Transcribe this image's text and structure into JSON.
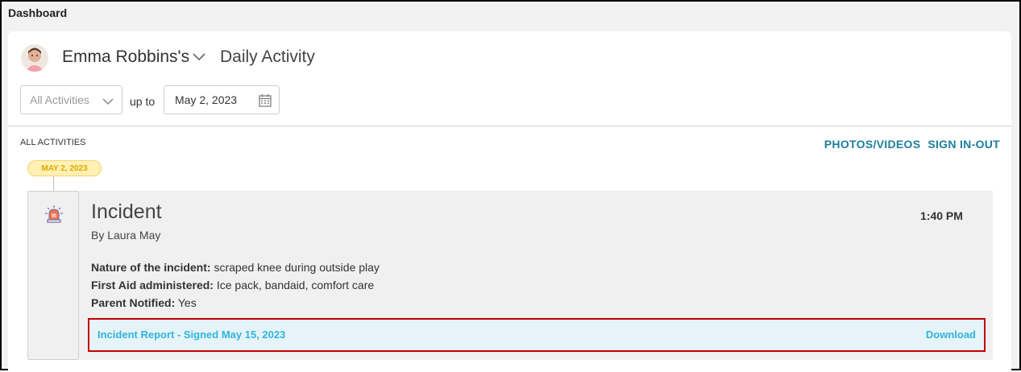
{
  "header": {
    "title": "Dashboard"
  },
  "child": {
    "name": "Emma Robbins's",
    "page_title": "Daily Activity"
  },
  "filters": {
    "activity_select": "All Activities",
    "up_to_label": "up to",
    "date_value": "May 2, 2023"
  },
  "section": {
    "label": "ALL ACTIVITIES",
    "links": [
      "PHOTOS/VIDEOS",
      "SIGN IN-OUT"
    ]
  },
  "timeline": {
    "date_pill": "MAY 2, 2023"
  },
  "entry": {
    "icon": "alarm-siren-icon",
    "title": "Incident",
    "author": "By Laura May",
    "time": "1:40 PM",
    "details": [
      {
        "label": "Nature of the incident:",
        "value": "scraped knee during outside play"
      },
      {
        "label": "First Aid administered:",
        "value": "Ice pack, bandaid, comfort care"
      },
      {
        "label": "Parent Notified:",
        "value": "Yes"
      }
    ],
    "report_link": "Incident Report - Signed May 15, 2023",
    "download_label": "Download"
  },
  "colors": {
    "accent_teal": "#1d7f9c",
    "link_blue": "#2fb5de",
    "highlight_red": "#c00000",
    "pill_yellow": "#fff0b3"
  }
}
